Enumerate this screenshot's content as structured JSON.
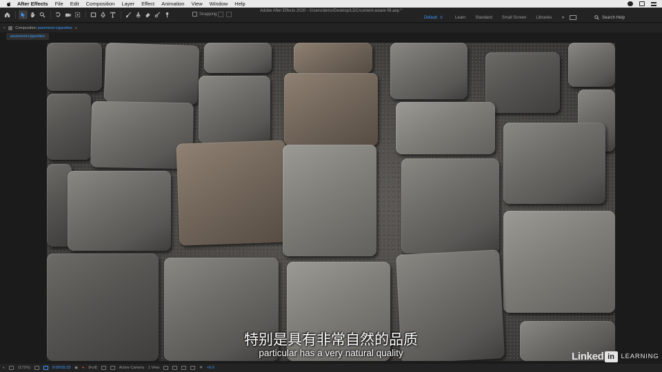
{
  "menubar": {
    "items": [
      "After Effects",
      "File",
      "Edit",
      "Composition",
      "Layer",
      "Effect",
      "Animation",
      "View",
      "Window",
      "Help"
    ]
  },
  "toolbar": {
    "window_title": "Adobe After Effects 2020 - /Users/demo/Desktop/LDC/content-aware-fill.aep *",
    "snapping_label": "Snapping",
    "workspaces": [
      "Default",
      "Learn",
      "Standard",
      "Small Screen",
      "Libraries"
    ],
    "active_workspace": "Default",
    "more_label": "»",
    "search_label": "Search Help"
  },
  "panel": {
    "close_label": "×",
    "composition_label": "Composition",
    "composition_name": "pavement-cigarettes",
    "menu_label": "≡",
    "tab_label": "pavement-cigarettes"
  },
  "subtitles": {
    "chinese": "特别是具有非常自然的品质",
    "english": "particular has a very natural quality"
  },
  "watermark": {
    "linked": "Linked",
    "in": "in",
    "learning": "LEARNING"
  },
  "viewer_bar": {
    "zoom": "(172%)",
    "timecode": "0:00:05:23",
    "resolution": "(Full)",
    "camera": "Active Camera",
    "views": "1 View",
    "exposure": "+0.0"
  },
  "colors": {
    "accent": "#3b9cff",
    "panel_bg": "#232323",
    "app_bg": "#1b1b1b"
  }
}
